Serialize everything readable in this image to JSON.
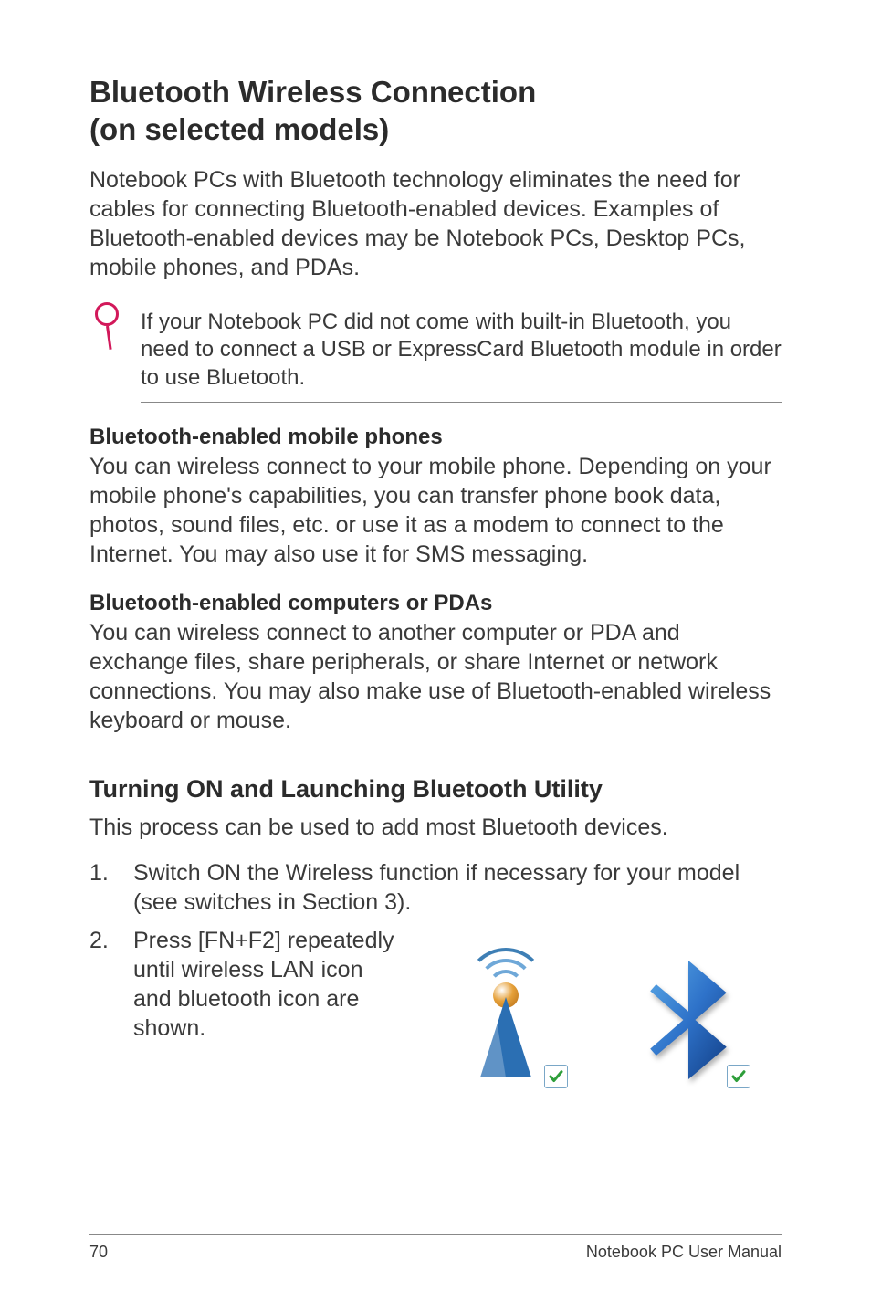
{
  "heading": {
    "line1": "Bluetooth Wireless Connection",
    "line2": "(on selected models)"
  },
  "intro": "Notebook PCs with Bluetooth technology eliminates the need for cables for connecting Bluetooth-enabled devices. Examples of Bluetooth-enabled devices may be Notebook PCs, Desktop PCs, mobile phones, and PDAs.",
  "note": "If your Notebook PC did not come with built-in Bluetooth, you need to connect a USB or ExpressCard Bluetooth module in order to use Bluetooth.",
  "sections": {
    "phones": {
      "title": "Bluetooth-enabled mobile phones",
      "body": "You can wireless connect to your mobile phone. Depending on your mobile phone's capabilities, you can transfer phone book data, photos, sound files, etc. or use it as a modem to connect to the Internet. You may also use it for SMS messaging."
    },
    "pdas": {
      "title": "Bluetooth-enabled computers or PDAs",
      "body": "You can wireless connect to another computer or PDA and exchange files, share peripherals, or share Internet or network connections. You may also make use of Bluetooth-enabled wireless keyboard or mouse."
    }
  },
  "subheading": "Turning ON and Launching Bluetooth Utility",
  "subintro": "This process can be used to add most Bluetooth devices.",
  "steps": [
    {
      "num": "1.",
      "text": "Switch ON the Wireless function if necessary for your model (see switches in Section 3)."
    },
    {
      "num": "2.",
      "text": "Press [FN+F2] repeatedly until wireless LAN icon and bluetooth icon are shown."
    }
  ],
  "icons": {
    "wifi": "wireless-lan-enabled-icon",
    "bluetooth": "bluetooth-enabled-icon"
  },
  "footer": {
    "page": "70",
    "label": "Notebook PC User Manual"
  }
}
